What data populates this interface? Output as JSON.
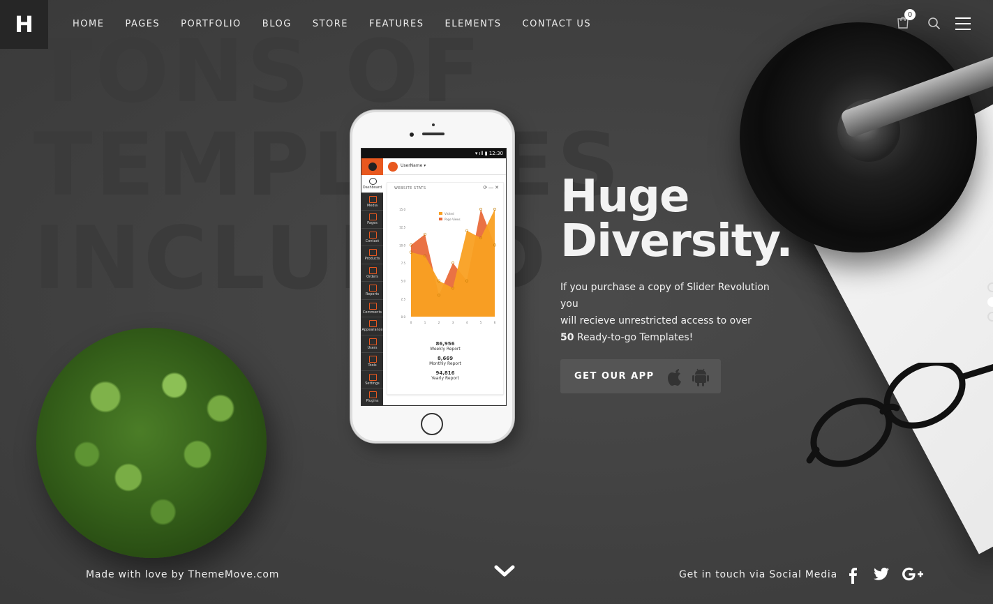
{
  "header": {
    "logo": "H",
    "nav": [
      "HOME",
      "PAGES",
      "PORTFOLIO",
      "BLOG",
      "STORE",
      "FEATURES",
      "ELEMENTS",
      "CONTACT US"
    ],
    "cart_count": "0"
  },
  "background_text": [
    "TONS OF",
    "TEMPLATES",
    "INCLUDED"
  ],
  "phone": {
    "time": "12:30",
    "username": "UserName ▾",
    "sidebar": [
      "Dashboard",
      "Media",
      "Pages",
      "Contact",
      "Products",
      "Orders",
      "Reports",
      "Comments",
      "Appearance",
      "Users",
      "Tools",
      "Settings",
      "Plugins"
    ],
    "panel_title": "WEBSITE STATS",
    "legend": [
      "Visited",
      "Page Views"
    ],
    "y_ticks": [
      "15.0",
      "12.5",
      "10.0",
      "7.5",
      "5.0",
      "2.5",
      "0.0"
    ],
    "x_ticks": [
      "0",
      "1",
      "2",
      "3",
      "4",
      "5",
      "6"
    ],
    "stats": [
      {
        "value": "86,956",
        "label": "Weekly Report"
      },
      {
        "value": "8,669",
        "label": "Monthly Report"
      },
      {
        "value": "94,816",
        "label": "Yearly Report"
      }
    ]
  },
  "chart_data": {
    "type": "area",
    "x": [
      0,
      1,
      2,
      3,
      4,
      5,
      6
    ],
    "series": [
      {
        "name": "Visited",
        "values": [
          9.0,
          8.5,
          5.0,
          4.0,
          12.0,
          11.0,
          15.0
        ],
        "color": "#f9a022"
      },
      {
        "name": "Page Views",
        "values": [
          10.0,
          11.5,
          3.0,
          7.5,
          5.0,
          15.0,
          10.0
        ],
        "color": "#e96a3a"
      }
    ],
    "ylim": [
      0,
      15
    ],
    "title": "WEBSITE STATS"
  },
  "hero": {
    "title_line1": "Huge",
    "title_line2": "Diversity.",
    "text_line1": "If you purchase a copy of Slider Revolution you",
    "text_line2": "will recieve unrestricted access to over",
    "count": "50",
    "text_line3": " Ready-to-go Templates!",
    "button": "GET OUR APP"
  },
  "footer": {
    "left": "Made with love by ThemeMove.com",
    "right": "Get in touch via Social Media"
  },
  "colors": {
    "background": "#414141",
    "accent": "#e8581f",
    "button": "#555555"
  }
}
